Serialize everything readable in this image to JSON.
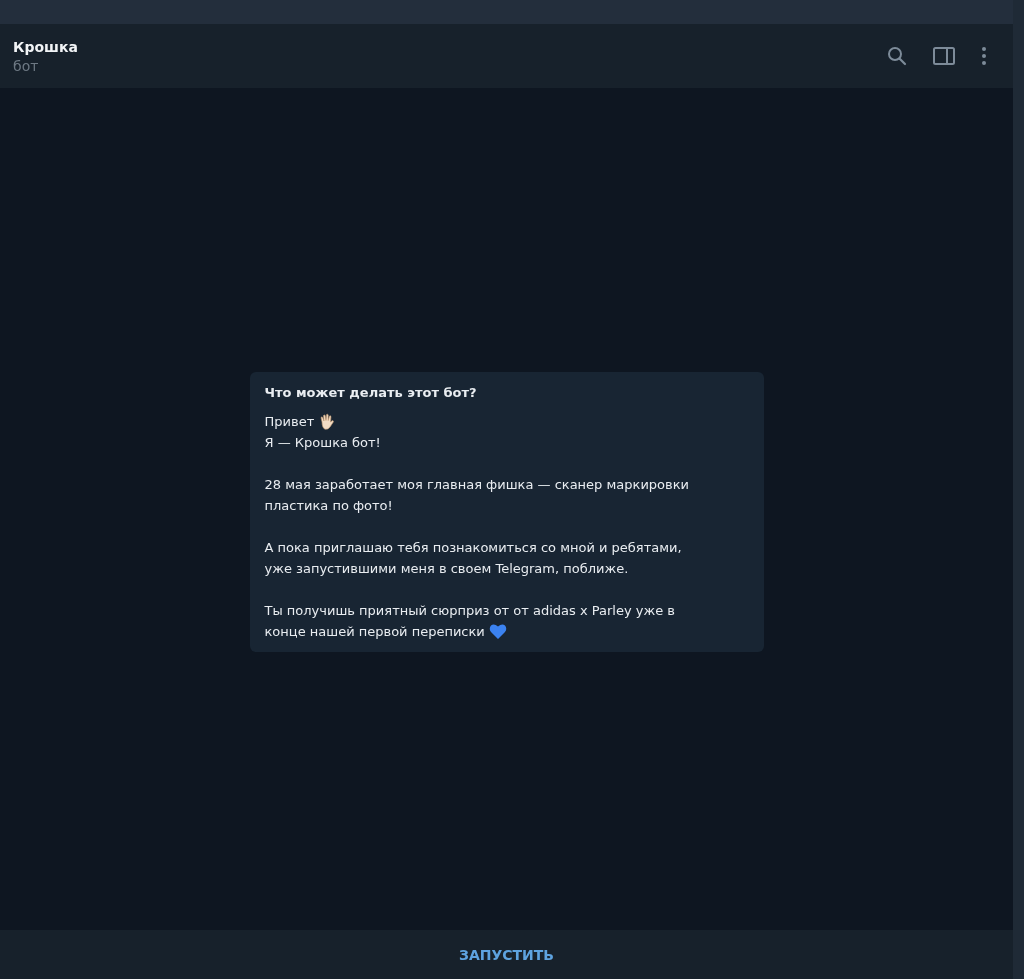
{
  "header": {
    "title": "Крошка",
    "subtitle": "бот"
  },
  "intro_card": {
    "title": "Что может делать этот бот?",
    "paragraphs": [
      {
        "lines": [
          {
            "text": "Привет"
          },
          {
            "text": "Я — Крошка бот!"
          }
        ]
      },
      {
        "lines": [
          {
            "text": "28 мая заработает моя главная фишка — сканер маркировки"
          },
          {
            "text": "пластика по фото!"
          }
        ]
      },
      {
        "lines": [
          {
            "text": "А пока приглашаю тебя познакомиться со мной и ребятами,"
          },
          {
            "text": "уже запустившими меня в своем Telegram, поближе."
          }
        ]
      },
      {
        "lines": [
          {
            "text": "Ты получишь приятный сюрприз от от adidas x Parley уже в"
          },
          {
            "text": "конце нашей первой переписки"
          }
        ]
      }
    ]
  },
  "start_button": {
    "label": "ЗАПУСТИТЬ"
  }
}
